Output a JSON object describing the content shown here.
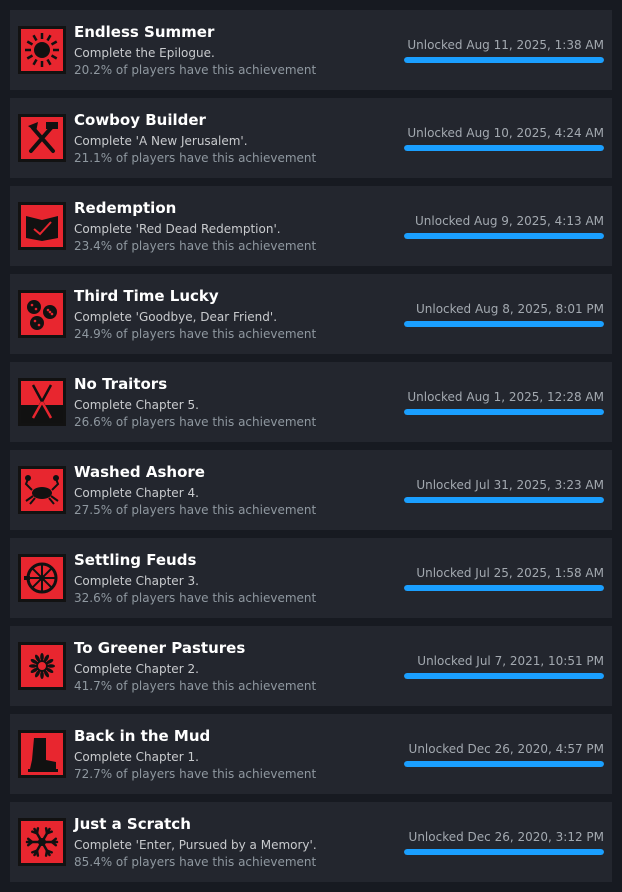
{
  "achievements": [
    {
      "title": "Endless Summer",
      "description": "Complete the Epilogue.",
      "percent": "20.2% of players have this achievement",
      "unlocked": "Unlocked Aug 11, 2025, 1:38 AM",
      "progress": 100,
      "icon": "sun-icon"
    },
    {
      "title": "Cowboy Builder",
      "description": "Complete 'A New Jerusalem'.",
      "percent": "21.1% of players have this achievement",
      "unlocked": "Unlocked Aug 10, 2025, 4:24 AM",
      "progress": 100,
      "icon": "hammer-axe-icon"
    },
    {
      "title": "Redemption",
      "description": "Complete 'Red Dead Redemption'.",
      "percent": "23.4% of players have this achievement",
      "unlocked": "Unlocked Aug 9, 2025, 4:13 AM",
      "progress": 100,
      "icon": "journal-icon"
    },
    {
      "title": "Third Time Lucky",
      "description": "Complete 'Goodbye, Dear Friend'.",
      "percent": "24.9% of players have this achievement",
      "unlocked": "Unlocked Aug 8, 2025, 8:01 PM",
      "progress": 100,
      "icon": "dice-icon"
    },
    {
      "title": "No Traitors",
      "description": "Complete Chapter 5.",
      "percent": "26.6% of players have this achievement",
      "unlocked": "Unlocked Aug 1, 2025, 12:28 AM",
      "progress": 100,
      "icon": "crossed-swords-icon"
    },
    {
      "title": "Washed Ashore",
      "description": "Complete Chapter 4.",
      "percent": "27.5% of players have this achievement",
      "unlocked": "Unlocked Jul 31, 2025, 3:23 AM",
      "progress": 100,
      "icon": "crab-icon"
    },
    {
      "title": "Settling Feuds",
      "description": "Complete Chapter 3.",
      "percent": "32.6% of players have this achievement",
      "unlocked": "Unlocked Jul 25, 2025, 1:58 AM",
      "progress": 100,
      "icon": "wagon-wheel-icon"
    },
    {
      "title": "To Greener Pastures",
      "description": "Complete Chapter 2.",
      "percent": "41.7% of players have this achievement",
      "unlocked": "Unlocked Jul 7, 2021, 10:51 PM",
      "progress": 100,
      "icon": "flower-icon"
    },
    {
      "title": "Back in the Mud",
      "description": "Complete Chapter 1.",
      "percent": "72.7% of players have this achievement",
      "unlocked": "Unlocked Dec 26, 2020, 4:57 PM",
      "progress": 100,
      "icon": "boot-icon"
    },
    {
      "title": "Just a Scratch",
      "description": "Complete 'Enter, Pursued by a Memory'.",
      "percent": "85.4% of players have this achievement",
      "unlocked": "Unlocked Dec 26, 2020, 3:12 PM",
      "progress": 100,
      "icon": "snowflake-icon"
    }
  ],
  "colors": {
    "background": "#171a21",
    "row": "#23262e",
    "icon_red": "#e8262f",
    "progress": "#1a9fff"
  }
}
